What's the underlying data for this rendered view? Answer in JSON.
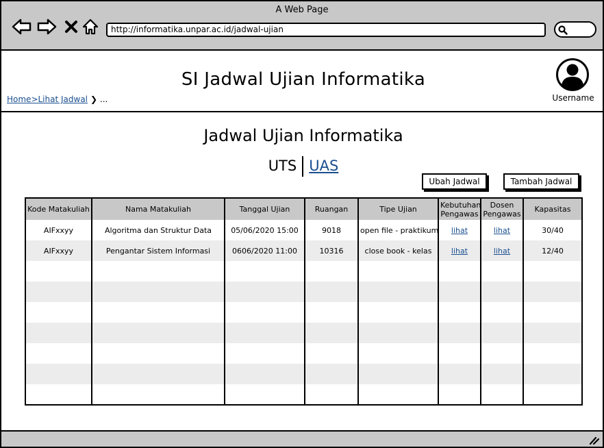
{
  "window": {
    "title": "A Web Page"
  },
  "browser": {
    "url": "http://informatika.unpar.ac.id/jadwal-ujian",
    "back_icon": "arrow-left-icon",
    "forward_icon": "arrow-right-icon",
    "close_icon": "x-icon",
    "home_icon": "home-icon",
    "search_icon": "search-icon"
  },
  "header": {
    "site_title": "SI Jadwal Ujian Informatika",
    "breadcrumb": {
      "link": "Home>Lihat Jadwal",
      "trail": "❯ ..."
    },
    "username": "Username",
    "avatar_icon": "user-avatar-icon"
  },
  "main": {
    "heading": "Jadwal Ujian Informatika",
    "tabs": [
      {
        "label": "UTS",
        "active": false
      },
      {
        "label": "UAS",
        "active": true
      }
    ],
    "buttons": {
      "ubah": "Ubah Jadwal",
      "tambah": "Tambah Jadwal"
    },
    "table": {
      "columns": [
        "Kode Matakuliah",
        "Nama Matakuliah",
        "Tanggal Ujian",
        "Ruangan",
        "Tipe Ujian",
        "Kebutuhan Pengawas",
        "Dosen Pengawas",
        "Kapasitas"
      ],
      "rows": [
        [
          "AIFxxyy",
          "Algoritma dan Struktur Data",
          "05/06/2020 15:00",
          "9018",
          "open file - praktikum",
          "lihat",
          "lihat",
          "30/40"
        ],
        [
          "AIFxxyy",
          "Pengantar Sistem Informasi",
          "0606/2020 11:00",
          "10316",
          "close book - kelas",
          "lihat",
          "lihat",
          "12/40"
        ]
      ]
    }
  },
  "colors": {
    "chrome": "#c8c8c8",
    "link": "#1a4f8f",
    "row_alt": "#ececec"
  }
}
